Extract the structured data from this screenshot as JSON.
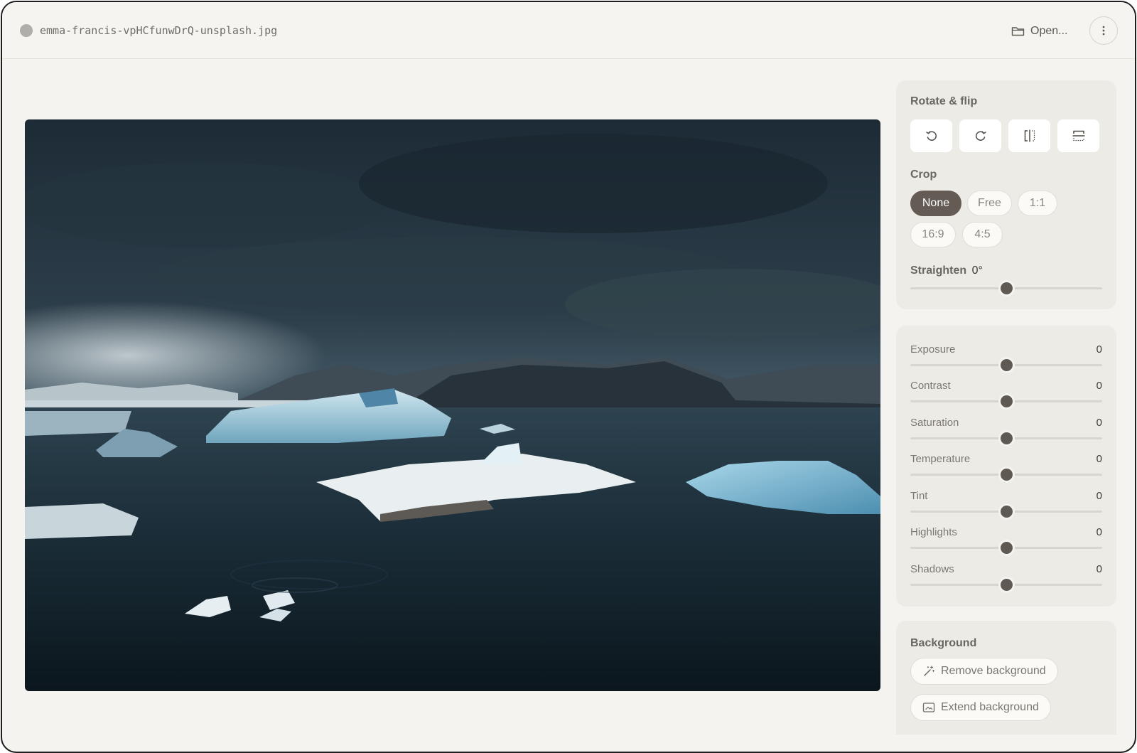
{
  "topbar": {
    "filename": "emma-francis-vpHCfunwDrQ-unsplash.jpg",
    "open_label": "Open...",
    "more_icon": "more-vertical-icon"
  },
  "canvas": {
    "image_alt": "Icebergs floating in a glacier lagoon under dark storm clouds"
  },
  "rotate": {
    "title": "Rotate & flip",
    "buttons": [
      "rotate-left-icon",
      "rotate-right-icon",
      "flip-horizontal-icon",
      "flip-vertical-icon"
    ]
  },
  "crop": {
    "title": "Crop",
    "options": [
      "None",
      "Free",
      "1:1",
      "16:9",
      "4:5"
    ],
    "selected": "None"
  },
  "straighten": {
    "label": "Straighten",
    "value": "0°",
    "level": 0.5
  },
  "adjustments": [
    {
      "label": "Exposure",
      "value": "0",
      "level": 0.5
    },
    {
      "label": "Contrast",
      "value": "0",
      "level": 0.5
    },
    {
      "label": "Saturation",
      "value": "0",
      "level": 0.5
    },
    {
      "label": "Temperature",
      "value": "0",
      "level": 0.5
    },
    {
      "label": "Tint",
      "value": "0",
      "level": 0.5
    },
    {
      "label": "Highlights",
      "value": "0",
      "level": 0.5
    },
    {
      "label": "Shadows",
      "value": "0",
      "level": 0.5
    }
  ],
  "background": {
    "title": "Background",
    "remove_label": "Remove background",
    "extend_label": "Extend background"
  },
  "colors": {
    "accent": "#645b54",
    "panel": "#edebe6",
    "app_bg": "#f4f3ef"
  }
}
